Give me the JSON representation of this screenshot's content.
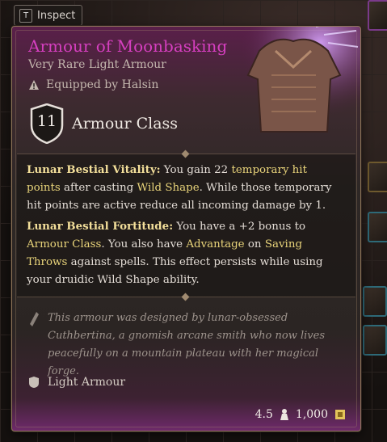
{
  "inspect": {
    "key": "T",
    "label": "Inspect"
  },
  "item": {
    "name": "Armour of Moonbasking",
    "rarity_type": "Very Rare Light Armour",
    "equipped_by": "Equipped by Halsin",
    "armour_class_value": "11",
    "armour_class_label": "Armour Class",
    "ability_1": {
      "name": "Lunar Bestial Vitality:",
      "t1": " You gain 22 ",
      "l1": "temporary hit points",
      "t2": " after casting ",
      "l2": "Wild Shape",
      "t3": ". While those temporary hit points are active reduce all incoming damage by 1."
    },
    "ability_2": {
      "name": "Lunar Bestial Fortitude:",
      "t1": " You have a +2 bonus to ",
      "l1": "Armour Class",
      "t2": ". You also have ",
      "l2": "Advantage",
      "t3": " on ",
      "l3": "Saving Throws",
      "t4": " against spells. This effect persists while using your druidic Wild Shape ability."
    },
    "lore": "This armour was designed by lunar-obsessed Cuthbertina, a gnomish arcane smith who now lives peacefully on a mountain plateau with her magical forge.",
    "category": "Light Armour",
    "weight": "4.5",
    "price": "1,000"
  },
  "colors": {
    "rarity_very_rare": "#d53fbf",
    "keyword": "#e9d47a"
  },
  "icons": [
    "warning-icon",
    "shield-ac-icon",
    "quill-icon",
    "armour-category-icon",
    "weight-icon",
    "gold-icon"
  ]
}
